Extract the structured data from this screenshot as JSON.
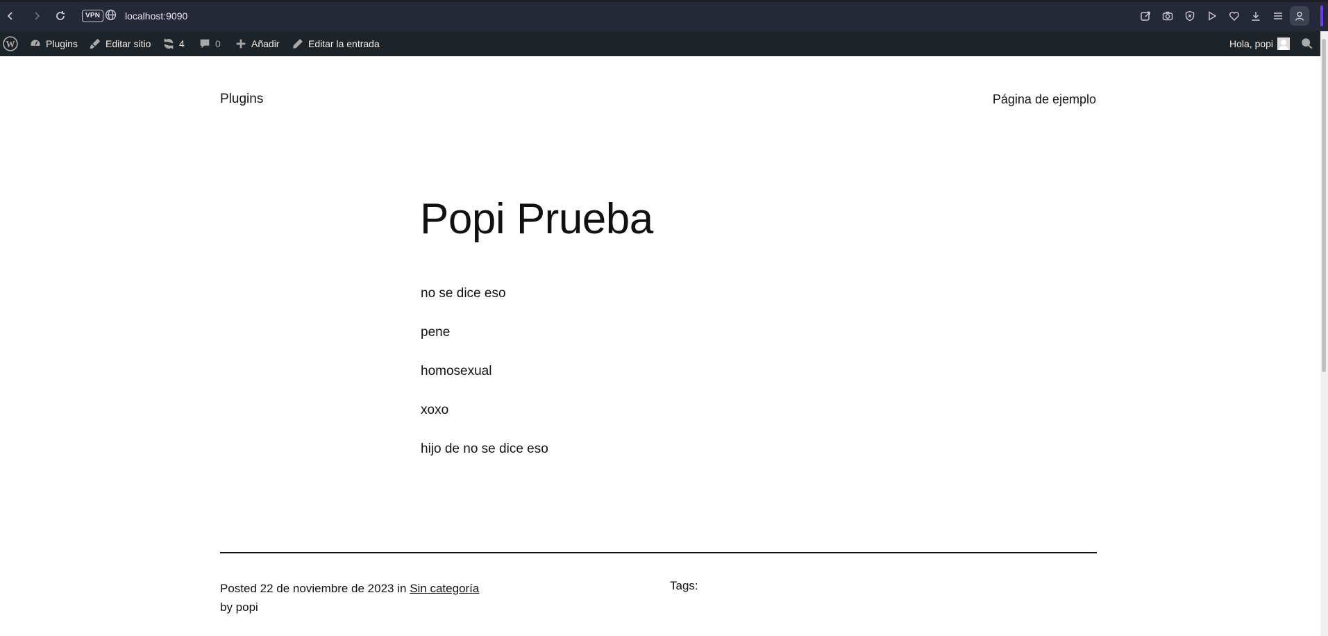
{
  "browser": {
    "url": "localhost:9090",
    "vpn_label": "VPN",
    "icons": [
      "back-icon",
      "forward-icon",
      "reload-icon",
      "globe-icon",
      "share-icon",
      "camera-icon",
      "shield-icon",
      "play-icon",
      "heart-icon",
      "download-icon",
      "menu-icon",
      "profile-icon"
    ]
  },
  "adminbar": {
    "plugins_label": "Plugins",
    "edit_site_label": "Editar sitio",
    "updates_count": "4",
    "comments_count": "0",
    "add_label": "Añadir",
    "edit_post_label": "Editar la entrada",
    "greeting": "Hola, popi"
  },
  "site": {
    "title": "Plugins",
    "nav_link": "Página de ejemplo"
  },
  "post": {
    "title": "Popi Prueba",
    "paragraphs": [
      "no se dice eso",
      "pene",
      "homosexual",
      "xoxo",
      "hijo de no se dice eso"
    ],
    "meta": {
      "posted_prefix": "Posted",
      "date": "22 de noviembre de 2023",
      "in_word": "in",
      "category": "Sin categoría",
      "by_line": "by popi",
      "tags_label": "Tags:"
    }
  }
}
